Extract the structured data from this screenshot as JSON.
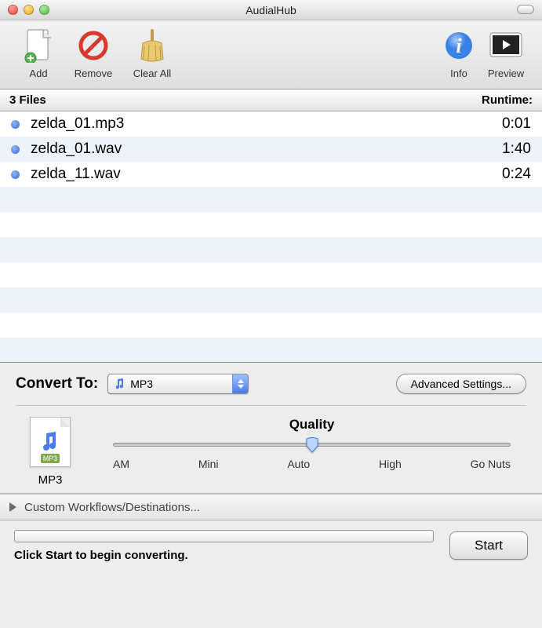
{
  "window": {
    "title": "AudialHub"
  },
  "toolbar": {
    "add": "Add",
    "remove": "Remove",
    "clearAll": "Clear All",
    "info": "Info",
    "preview": "Preview"
  },
  "listHeader": {
    "count": "3 Files",
    "runtime": "Runtime:"
  },
  "files": [
    {
      "name": "zelda_01.mp3",
      "duration": "0:01"
    },
    {
      "name": "zelda_01.wav",
      "duration": "1:40"
    },
    {
      "name": "zelda_11.wav",
      "duration": "0:24"
    }
  ],
  "settings": {
    "convertLabel": "Convert To:",
    "formatSelected": "MP3",
    "advancedButton": "Advanced Settings...",
    "formatIconLabel": "MP3",
    "formatTag": "MP3",
    "qualityLabel": "Quality",
    "qualityTicks": [
      "AM",
      "Mini",
      "Auto",
      "High",
      "Go Nuts"
    ],
    "qualityValueIndex": 2
  },
  "disclosure": {
    "label": "Custom Workflows/Destinations..."
  },
  "footer": {
    "status": "Click Start to begin converting.",
    "startButton": "Start"
  }
}
